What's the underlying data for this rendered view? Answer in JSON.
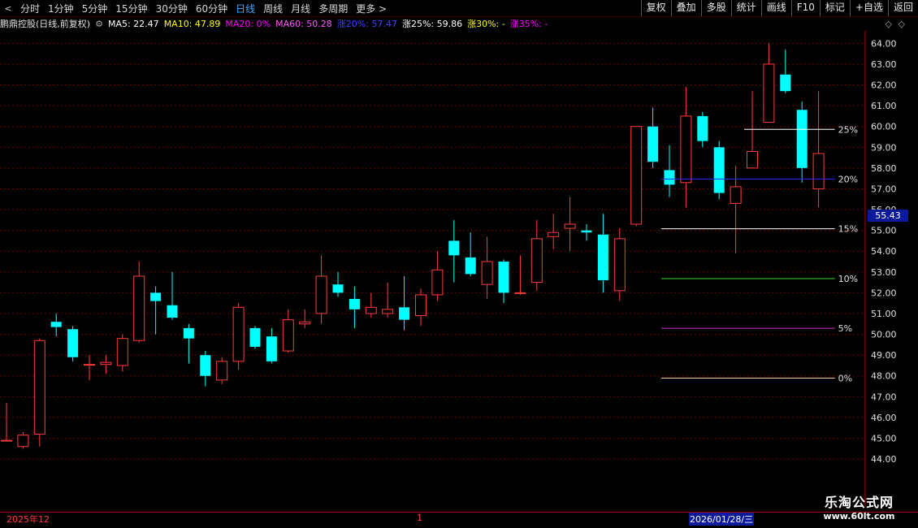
{
  "toolbar": {
    "nav_prev": "<",
    "nav_next": ">",
    "tabs": [
      {
        "label": "分时",
        "active": false
      },
      {
        "label": "1分钟",
        "active": false
      },
      {
        "label": "5分钟",
        "active": false
      },
      {
        "label": "15分钟",
        "active": false
      },
      {
        "label": "30分钟",
        "active": false
      },
      {
        "label": "60分钟",
        "active": false
      },
      {
        "label": "日线",
        "active": true
      },
      {
        "label": "周线",
        "active": false
      },
      {
        "label": "月线",
        "active": false
      },
      {
        "label": "多周期",
        "active": false
      },
      {
        "label": "更多 >",
        "active": false
      }
    ],
    "right_buttons": [
      "复权",
      "叠加",
      "多股",
      "统计",
      "画线",
      "F10",
      "标记",
      "+自选",
      "返回"
    ]
  },
  "infobar": {
    "stock": "鹏鼎控股(日线,前复权)",
    "ma5": "MA5: 22.47",
    "ma10": "MA10: 47.89",
    "ma20": "MA20: 0%",
    "ma60": "MA60: 50.28",
    "rise20": "涨20%: 57.47",
    "rise25": "涨25%: 59.86",
    "rise30": "涨30%: -",
    "rise35": "涨35%: -"
  },
  "colors": {
    "up": "#ff3c3c",
    "down": "#00ffff",
    "grid": "#6a0000",
    "axis_text": "#e0e0e0",
    "ma5": "#ffffff",
    "ma10": "#ffff00",
    "ma20": "#ff00ff",
    "ma60": "#ff55ff",
    "rise20": "#4040ff",
    "rise30": "#ffff00",
    "rise35": "#ff00ff"
  },
  "price_tag": "55.43",
  "date_axis": {
    "left_label": "2025年12",
    "mid_label": "1",
    "cursor_label": "2026/01/28/三"
  },
  "watermark": {
    "name": "乐淘公式网",
    "url": "www.60lt.com"
  },
  "chart_data": {
    "type": "candlestick",
    "ylim": [
      43.3,
      64.6
    ],
    "yticks": [
      "64.00",
      "63.00",
      "62.00",
      "61.00",
      "60.00",
      "59.00",
      "58.00",
      "57.00",
      "56.00",
      "55.00",
      "54.00",
      "53.00",
      "52.00",
      "51.00",
      "50.00",
      "49.00",
      "48.00",
      "47.00",
      "46.00",
      "45.00",
      "44.00"
    ],
    "candles": [
      {
        "o": 44.9,
        "c": 44.9,
        "h": 46.7,
        "l": 44.85
      },
      {
        "o": 44.6,
        "c": 45.15,
        "h": 45.3,
        "l": 44.5
      },
      {
        "o": 45.2,
        "c": 49.7,
        "h": 49.8,
        "l": 44.6
      },
      {
        "o": 50.6,
        "c": 50.35,
        "h": 51.0,
        "l": 49.9
      },
      {
        "o": 50.25,
        "c": 48.9,
        "h": 50.4,
        "l": 48.7
      },
      {
        "o": 48.55,
        "c": 48.55,
        "h": 49.0,
        "l": 47.8
      },
      {
        "o": 48.55,
        "c": 48.65,
        "h": 49.0,
        "l": 48.1
      },
      {
        "o": 48.5,
        "c": 49.8,
        "h": 50.0,
        "l": 48.2
      },
      {
        "o": 49.7,
        "c": 52.8,
        "h": 53.5,
        "l": 49.6
      },
      {
        "o": 52.0,
        "c": 51.6,
        "h": 52.3,
        "l": 50.0
      },
      {
        "o": 51.4,
        "c": 50.8,
        "h": 53.0,
        "l": 50.7
      },
      {
        "o": 50.3,
        "c": 49.8,
        "h": 50.5,
        "l": 48.6
      },
      {
        "o": 49.0,
        "c": 48.0,
        "h": 49.2,
        "l": 47.5
      },
      {
        "o": 47.8,
        "c": 48.7,
        "h": 48.9,
        "l": 47.6
      },
      {
        "o": 48.7,
        "c": 51.3,
        "h": 51.5,
        "l": 48.3
      },
      {
        "o": 50.3,
        "c": 49.4,
        "h": 50.4,
        "l": 49.3
      },
      {
        "o": 49.9,
        "c": 48.7,
        "h": 50.3,
        "l": 48.6
      },
      {
        "o": 49.2,
        "c": 50.7,
        "h": 51.2,
        "l": 49.1
      },
      {
        "o": 50.5,
        "c": 50.6,
        "h": 51.2,
        "l": 50.3
      },
      {
        "o": 51.0,
        "c": 52.8,
        "h": 53.8,
        "l": 50.5
      },
      {
        "o": 52.4,
        "c": 52.0,
        "h": 53.0,
        "l": 51.8
      },
      {
        "o": 51.7,
        "c": 51.2,
        "h": 52.3,
        "l": 50.3
      },
      {
        "o": 51.0,
        "c": 51.3,
        "h": 52.0,
        "l": 50.8
      },
      {
        "o": 51.0,
        "c": 51.2,
        "h": 52.5,
        "l": 50.8
      },
      {
        "o": 51.3,
        "c": 50.7,
        "h": 52.8,
        "l": 50.2
      },
      {
        "o": 50.9,
        "c": 51.9,
        "h": 52.2,
        "l": 50.4
      },
      {
        "o": 51.9,
        "c": 53.1,
        "h": 54.0,
        "l": 51.6
      },
      {
        "o": 54.5,
        "c": 53.8,
        "h": 55.5,
        "l": 52.5
      },
      {
        "o": 53.7,
        "c": 52.9,
        "h": 54.9,
        "l": 52.8
      },
      {
        "o": 52.4,
        "c": 53.5,
        "h": 54.7,
        "l": 51.7
      },
      {
        "o": 53.5,
        "c": 52.0,
        "h": 53.6,
        "l": 51.5
      },
      {
        "o": 52.0,
        "c": 52.0,
        "h": 53.8,
        "l": 51.9
      },
      {
        "o": 52.5,
        "c": 54.6,
        "h": 55.5,
        "l": 52.1
      },
      {
        "o": 54.7,
        "c": 54.9,
        "h": 55.8,
        "l": 54.1
      },
      {
        "o": 55.1,
        "c": 55.3,
        "h": 56.6,
        "l": 54.0
      },
      {
        "o": 55.0,
        "c": 54.9,
        "h": 55.3,
        "l": 54.5
      },
      {
        "o": 54.8,
        "c": 52.6,
        "h": 55.8,
        "l": 52.0
      },
      {
        "o": 52.1,
        "c": 54.6,
        "h": 55.1,
        "l": 51.6
      },
      {
        "o": 55.3,
        "c": 60.0,
        "h": 60.0,
        "l": 55.2
      },
      {
        "o": 60.0,
        "c": 58.3,
        "h": 60.9,
        "l": 58.0
      },
      {
        "o": 57.9,
        "c": 57.2,
        "h": 59.1,
        "l": 56.6
      },
      {
        "o": 57.3,
        "c": 60.5,
        "h": 61.9,
        "l": 56.1
      },
      {
        "o": 60.5,
        "c": 59.3,
        "h": 60.7,
        "l": 59.0
      },
      {
        "o": 59.0,
        "c": 56.8,
        "h": 59.3,
        "l": 56.5
      },
      {
        "o": 56.3,
        "c": 57.1,
        "h": 58.1,
        "l": 53.9
      },
      {
        "o": 58.0,
        "c": 58.8,
        "h": 61.7,
        "l": 58.0
      },
      {
        "o": 60.2,
        "c": 63.0,
        "h": 64.0,
        "l": 60.2
      },
      {
        "o": 62.5,
        "c": 61.7,
        "h": 63.7,
        "l": 61.6
      },
      {
        "o": 60.8,
        "c": 58.0,
        "h": 61.2,
        "l": 57.3
      },
      {
        "o": 57.0,
        "c": 58.7,
        "h": 61.7,
        "l": 56.1
      }
    ],
    "levels": [
      {
        "label": "25%",
        "value": 59.86,
        "color": "#ffffff",
        "x_start_index": 45
      },
      {
        "label": "20%",
        "value": 57.47,
        "color": "#2a2aff",
        "x_start_index": 40
      },
      {
        "label": "15%",
        "value": 55.08,
        "color": "#ffffff",
        "x_start_index": 40
      },
      {
        "label": "10%",
        "value": 52.68,
        "color": "#33dd33",
        "x_start_index": 40
      },
      {
        "label": "5%",
        "value": 50.29,
        "color": "#cc33cc",
        "x_start_index": 40
      },
      {
        "label": "0%",
        "value": 47.89,
        "color": "#ffcc99",
        "x_start_index": 40
      }
    ]
  }
}
